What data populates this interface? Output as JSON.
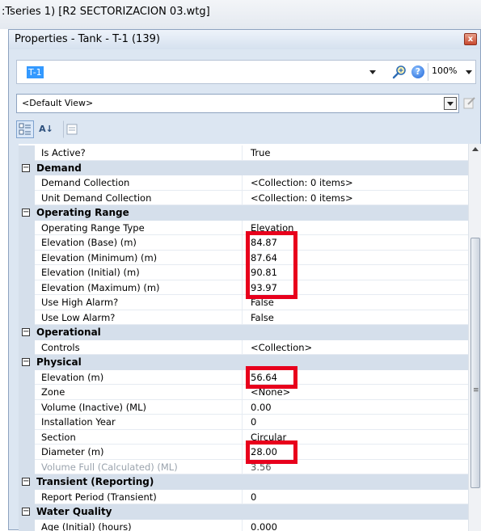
{
  "app_title": ":Tseries 1) [R2 SECTORIZACION 03.wtg]",
  "panel": {
    "title": "Properties - Tank - T-1 (139)",
    "close_label": "x",
    "element_selector_value": "T-1",
    "zoom_value": "100%",
    "help_label": "?",
    "view_value": "<Default View>"
  },
  "toolbar": {
    "sort_alpha_label": "A↓"
  },
  "grid": {
    "rows": [
      {
        "type": "prop",
        "name": "Is Active?",
        "value": "True"
      },
      {
        "type": "cat",
        "name": "Demand"
      },
      {
        "type": "prop",
        "name": "Demand Collection",
        "value": "<Collection: 0 items>"
      },
      {
        "type": "prop",
        "name": "Unit Demand Collection",
        "value": "<Collection: 0 items>"
      },
      {
        "type": "cat",
        "name": "Operating Range"
      },
      {
        "type": "prop",
        "name": "Operating Range Type",
        "value": "Elevation"
      },
      {
        "type": "prop",
        "name": "Elevation (Base) (m)",
        "value": "84.87"
      },
      {
        "type": "prop",
        "name": "Elevation (Minimum) (m)",
        "value": "87.64"
      },
      {
        "type": "prop",
        "name": "Elevation (Initial) (m)",
        "value": "90.81"
      },
      {
        "type": "prop",
        "name": "Elevation (Maximum) (m)",
        "value": "93.97"
      },
      {
        "type": "prop",
        "name": "Use High Alarm?",
        "value": "False"
      },
      {
        "type": "prop",
        "name": "Use Low Alarm?",
        "value": "False"
      },
      {
        "type": "cat",
        "name": "Operational"
      },
      {
        "type": "prop",
        "name": "Controls",
        "value": "<Collection>"
      },
      {
        "type": "cat",
        "name": "Physical"
      },
      {
        "type": "prop",
        "name": "Elevation (m)",
        "value": "56.64"
      },
      {
        "type": "prop",
        "name": "Zone",
        "value": "<None>"
      },
      {
        "type": "prop",
        "name": "Volume (Inactive) (ML)",
        "value": "0.00"
      },
      {
        "type": "prop",
        "name": "Installation Year",
        "value": "0"
      },
      {
        "type": "prop",
        "name": "Section",
        "value": "Circular"
      },
      {
        "type": "prop",
        "name": "Diameter (m)",
        "value": "28.00"
      },
      {
        "type": "prop",
        "name": "Volume Full (Calculated) (ML)",
        "value": "3.56",
        "disabled": true
      },
      {
        "type": "cat",
        "name": "Transient (Reporting)"
      },
      {
        "type": "prop",
        "name": "Report Period (Transient)",
        "value": "0"
      },
      {
        "type": "cat",
        "name": "Water Quality"
      },
      {
        "type": "prop",
        "name": "Age (Initial) (hours)",
        "value": "0.000"
      }
    ]
  },
  "highlight_color": "#e8001c"
}
